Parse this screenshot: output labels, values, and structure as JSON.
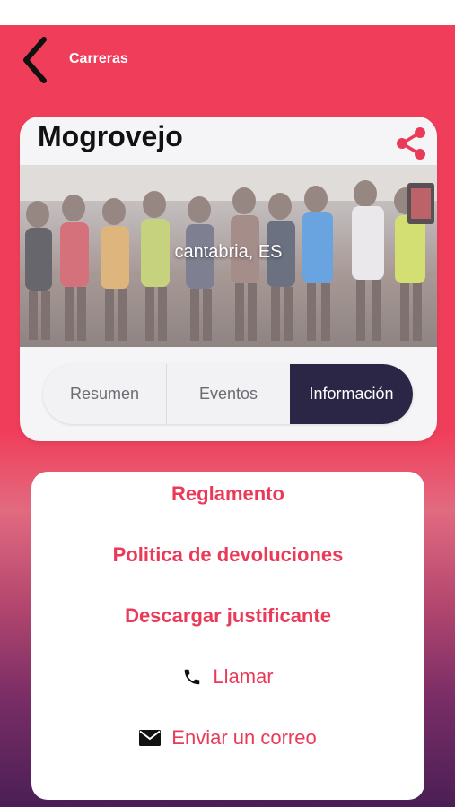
{
  "header": {
    "back_icon": "chevron-left-icon",
    "title": "Carreras"
  },
  "race": {
    "name": "Mogrovejo",
    "share_icon": "share-icon",
    "location": "cantabria, ES",
    "accent_color": "#f03e5a"
  },
  "tabs": [
    {
      "label": "Resumen",
      "active": false
    },
    {
      "label": "Eventos",
      "active": false
    },
    {
      "label": "Información",
      "active": true
    }
  ],
  "info": {
    "links": [
      {
        "label": "Reglamento"
      },
      {
        "label": "Politica de devoluciones"
      },
      {
        "label": "Descargar justificante"
      },
      {
        "label": "Llamar",
        "icon": "phone-icon"
      },
      {
        "label": "Enviar un correo",
        "icon": "envelope-icon"
      }
    ]
  }
}
